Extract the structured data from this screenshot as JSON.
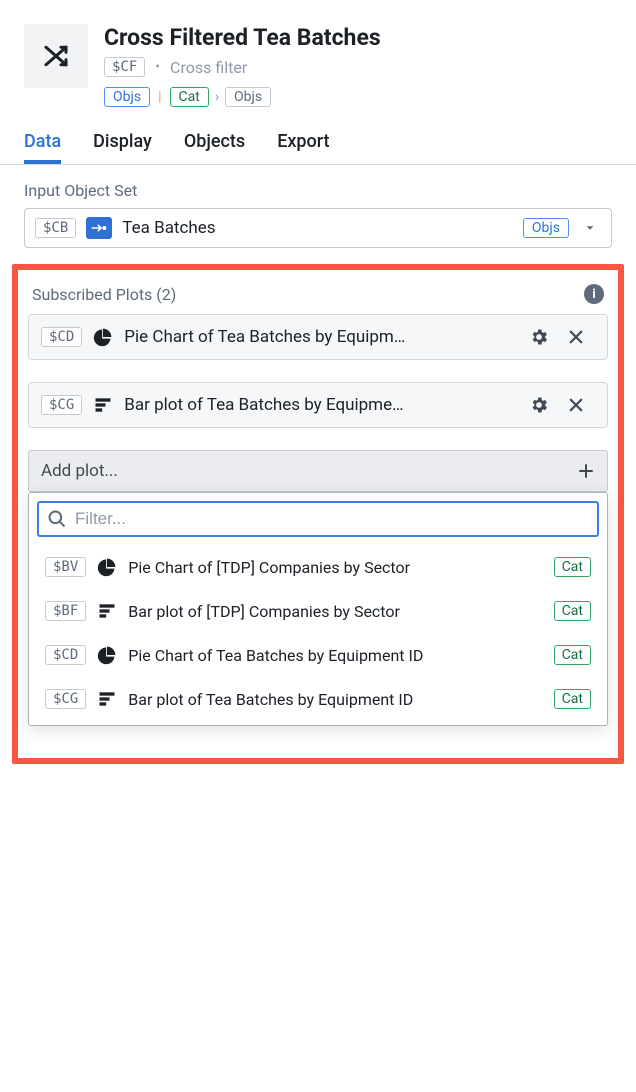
{
  "header": {
    "title": "Cross Filtered Tea Batches",
    "var": "$CF",
    "subtitle": "Cross filter",
    "breadcrumb": [
      {
        "label": "Objs",
        "style": "blue"
      },
      {
        "label": "Cat",
        "style": "green"
      },
      {
        "label": "Objs",
        "style": "gray"
      }
    ]
  },
  "tabs": [
    "Data",
    "Display",
    "Objects",
    "Export"
  ],
  "active_tab": "Data",
  "input_object_set": {
    "label": "Input Object Set",
    "var": "$CB",
    "name": "Tea Batches",
    "tag": "Objs"
  },
  "subscribed_plots": {
    "label": "Subscribed Plots (2)",
    "items": [
      {
        "var": "$CD",
        "icon": "pie",
        "name": "Pie Chart of Tea Batches by Equipm…"
      },
      {
        "var": "$CG",
        "icon": "bar",
        "name": "Bar plot of Tea Batches by Equipme…"
      }
    ]
  },
  "add_plot": {
    "label": "Add plot...",
    "filter_placeholder": "Filter...",
    "options": [
      {
        "var": "$BV",
        "icon": "pie",
        "name": "Pie Chart of [TDP] Companies by Sector",
        "tag": "Cat"
      },
      {
        "var": "$BF",
        "icon": "bar",
        "name": "Bar plot of [TDP] Companies by Sector",
        "tag": "Cat"
      },
      {
        "var": "$CD",
        "icon": "pie",
        "name": "Pie Chart of Tea Batches by Equipment ID",
        "tag": "Cat"
      },
      {
        "var": "$CG",
        "icon": "bar",
        "name": "Bar plot of Tea Batches by Equipment ID",
        "tag": "Cat"
      }
    ]
  }
}
